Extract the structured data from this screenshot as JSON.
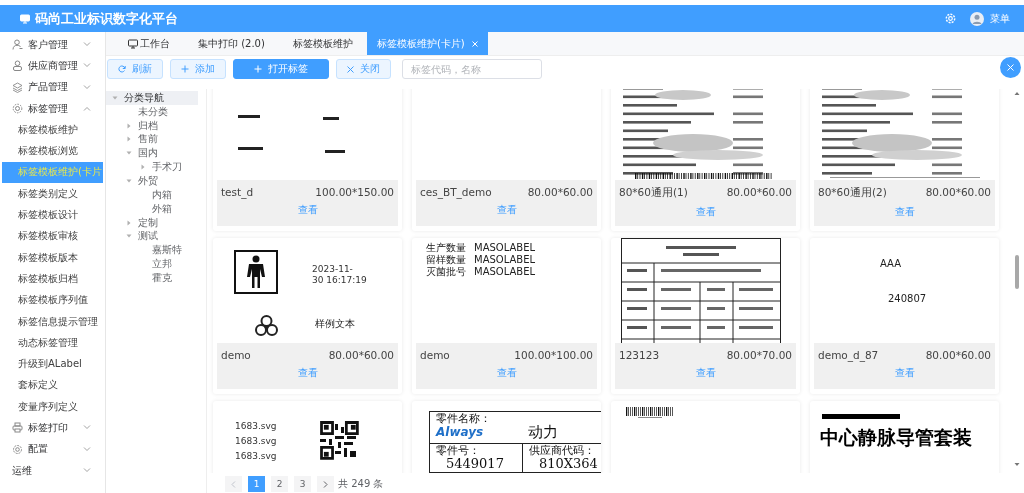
{
  "header": {
    "title": "码尚工业标识数字化平台",
    "user": "菜单"
  },
  "sidebar": {
    "items": [
      {
        "label": "客户管理",
        "expanded": false
      },
      {
        "label": "供应商管理",
        "expanded": false
      },
      {
        "label": "产品管理",
        "expanded": false
      },
      {
        "label": "标签管理",
        "expanded": true,
        "children": [
          {
            "label": "标签模板维护",
            "selected": false
          },
          {
            "label": "标签模板浏览",
            "selected": false
          },
          {
            "label": "标签模板维护(卡片",
            "selected": true
          },
          {
            "label": "标签类别定义",
            "selected": false
          },
          {
            "label": "标签模板设计",
            "selected": false
          },
          {
            "label": "标签模板审核",
            "selected": false
          },
          {
            "label": "标签模板版本",
            "selected": false
          },
          {
            "label": "标签模板归档",
            "selected": false
          },
          {
            "label": "标签模板序列值",
            "selected": false
          },
          {
            "label": "标签信息提示管理",
            "selected": false
          },
          {
            "label": "动态标签管理",
            "selected": false
          },
          {
            "label": "升级到ALabel",
            "selected": false
          },
          {
            "label": "套标定义",
            "selected": false
          },
          {
            "label": "变量序列定义",
            "selected": false
          }
        ]
      },
      {
        "label": "标签打印",
        "expanded": false
      },
      {
        "label": "配置",
        "expanded": false
      },
      {
        "label": "运维",
        "expanded": false
      }
    ]
  },
  "tabs": [
    {
      "label": "工作台",
      "selected": false
    },
    {
      "label": "集中打印 (2.0)",
      "selected": false
    },
    {
      "label": "标签模板维护",
      "selected": false
    },
    {
      "label": "标签模板维护(卡片)",
      "selected": true
    }
  ],
  "toolbar": {
    "buttons": [
      {
        "label": "刷新",
        "kind": "refresh"
      },
      {
        "label": "添加",
        "kind": "add"
      },
      {
        "label": "打开标签",
        "kind": "primary"
      },
      {
        "label": "关闭",
        "kind": "close"
      }
    ],
    "search": {
      "placeholder": "标签代码，名称"
    }
  },
  "tree": [
    {
      "label": "分类导航",
      "expanded": true,
      "selected": true,
      "children": [
        {
          "label": "未分类",
          "selected": false
        },
        {
          "label": "归档",
          "expanded": false,
          "selected": false
        },
        {
          "label": "售前",
          "expanded": false,
          "selected": false
        },
        {
          "label": "国内",
          "expanded": true,
          "selected": false,
          "children": [
            {
              "label": "手术刀",
              "expanded": false,
              "selected": false
            }
          ]
        },
        {
          "label": "外贸",
          "expanded": true,
          "selected": false,
          "children": [
            {
              "label": "内箱",
              "selected": false
            },
            {
              "label": "外箱",
              "selected": false
            }
          ]
        },
        {
          "label": "定制",
          "expanded": false,
          "selected": false
        },
        {
          "label": "测试",
          "expanded": true,
          "selected": false,
          "children": [
            {
              "label": "嘉斯特",
              "selected": false
            },
            {
              "label": "立邦",
              "selected": false
            },
            {
              "label": "霍克",
              "selected": false
            }
          ]
        }
      ]
    }
  ],
  "cards": [
    {
      "name": "test_d",
      "size": "100.00*150.00",
      "action": "查看",
      "preview": {
        "kind": "marks"
      }
    },
    {
      "name": "ces_BT_demo",
      "size": "80.00*60.00",
      "action": "查看",
      "preview": {
        "kind": "blank"
      }
    },
    {
      "name": "80*60通用(1)",
      "size": "80.00*60.00",
      "action": "查看",
      "preview": {
        "kind": "dense",
        "barcode": true
      }
    },
    {
      "name": "80*60通用(2)",
      "size": "80.00*60.00",
      "action": "查看",
      "preview": {
        "kind": "dense",
        "barcode": false
      }
    },
    {
      "name": "demo",
      "size": "80.00*60.00",
      "action": "查看",
      "preview": {
        "kind": "symbols",
        "date": [
          "2023-11-",
          "30 16:17:19"
        ],
        "caption": "样例文本"
      }
    },
    {
      "name": "demo",
      "size": "100.00*100.00",
      "action": "查看",
      "preview": {
        "kind": "fields",
        "rows": [
          {
            "label": "生产数量",
            "value": "MASOLABEL"
          },
          {
            "label": "留样数量",
            "value": "MASOLABEL"
          },
          {
            "label": "灭菌批号",
            "value": "MASOLABEL"
          }
        ]
      }
    },
    {
      "name": "123123",
      "size": "80.00*70.00",
      "action": "查看",
      "preview": {
        "kind": "table"
      }
    },
    {
      "name": "demo_d_87",
      "size": "80.00*60.00",
      "action": "查看",
      "preview": {
        "kind": "text",
        "lines": [
          "AAA",
          "240807"
        ]
      }
    },
    {
      "preview": {
        "kind": "files",
        "lines": [
          "1683.svg",
          "1683.svg",
          "1683.svg"
        ]
      }
    },
    {
      "preview": {
        "kind": "part",
        "name_label": "零件名称：",
        "logo": "Always",
        "name_value": "动力",
        "number_label": "零件号：",
        "number_value": "5449017",
        "supplier_label": "供应商代码：",
        "supplier_value": "810X364"
      }
    },
    {
      "preview": {
        "kind": "barcode"
      }
    },
    {
      "preview": {
        "kind": "heading",
        "text": "中心静脉导管套装"
      }
    }
  ],
  "pagination": {
    "pages": [
      {
        "label": "1",
        "selected": true
      },
      {
        "label": "2",
        "selected": false
      },
      {
        "label": "3",
        "selected": false
      }
    ],
    "total": "共 249 条"
  }
}
